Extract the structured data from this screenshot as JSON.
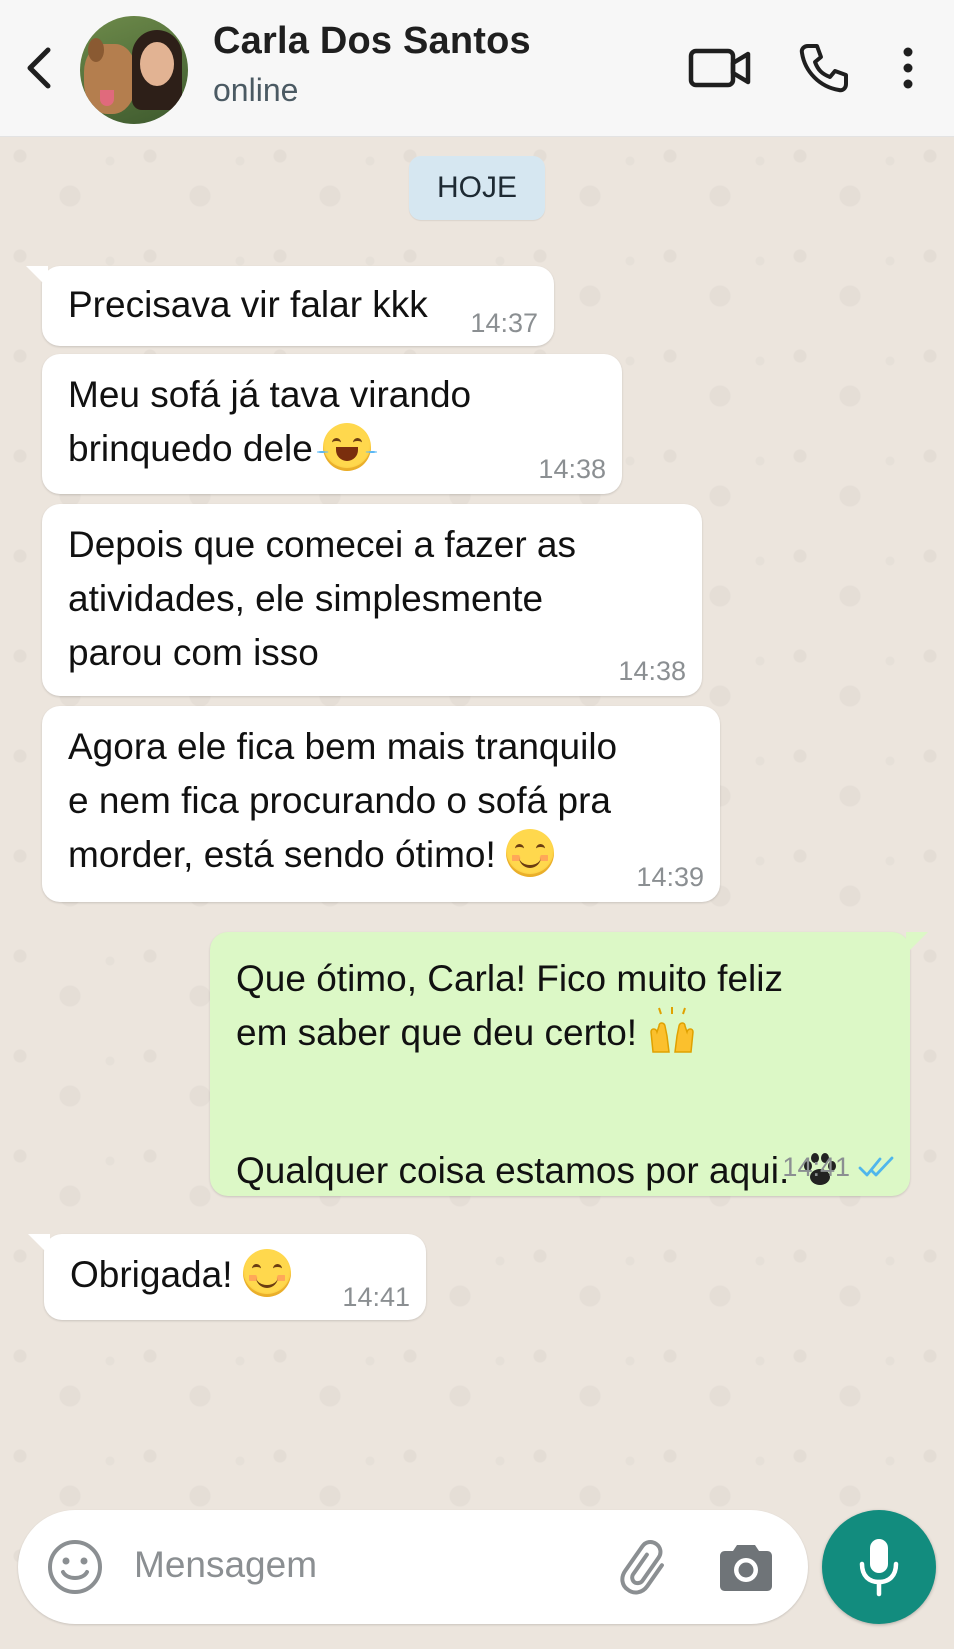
{
  "header": {
    "contact_name": "Carla Dos Santos",
    "status": "online"
  },
  "date_chip": "HOJE",
  "messages": [
    {
      "direction": "in",
      "text": "Precisava vir falar kkk",
      "time": "14:37"
    },
    {
      "direction": "in",
      "text": "Meu sofá já tava virando\nbrinquedo dele",
      "emoji": "laughing-tears",
      "time": "14:38"
    },
    {
      "direction": "in",
      "text": "Depois que comecei a fazer as\natividades, ele simplesmente\nparou com isso",
      "time": "14:38"
    },
    {
      "direction": "in",
      "text": "Agora ele fica bem mais tranquilo\ne nem fica procurando o sofá pra\nmorder, está sendo ótimo!",
      "emoji": "smiling-face",
      "time": "14:39"
    },
    {
      "direction": "out",
      "text": "Que ótimo, Carla! Fico muito feliz\nem saber que deu certo!",
      "emoji": "raising-hands",
      "text2": "Qualquer coisa estamos por aqui.",
      "emoji2": "paw-prints",
      "time": "14:41",
      "read_status": "read"
    },
    {
      "direction": "in",
      "text": "Obrigada!",
      "emoji": "smiling-face",
      "time": "14:41"
    }
  ],
  "composer": {
    "placeholder": "Mensagem"
  },
  "colors": {
    "accent": "#128c7e",
    "outgoing_bubble": "#dcf8c6",
    "incoming_bubble": "#ffffff",
    "read_ticks": "#4fb6ec"
  }
}
